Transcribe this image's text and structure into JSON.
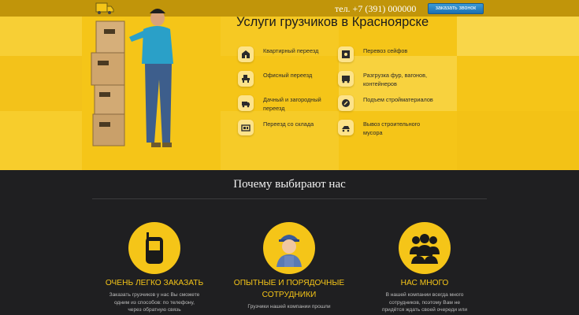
{
  "header": {
    "phone": "тел. +7 (391) 000000",
    "call_button": "заказать звонок"
  },
  "hero": {
    "title": "Услуги грузчиков в Красноярске",
    "services": [
      {
        "label": "Квартирный переезд",
        "icon": "apartment-move-icon"
      },
      {
        "label": "Перевоз сейфов",
        "icon": "safe-icon"
      },
      {
        "label": "Офисный переезд",
        "icon": "office-move-icon"
      },
      {
        "label": "Разгрузка фур, вагонов, контейнеров",
        "icon": "truck-unload-icon"
      },
      {
        "label": "Дачный и загородный переезд",
        "icon": "country-move-icon"
      },
      {
        "label": "Подъем стройматериалов",
        "icon": "building-materials-icon"
      },
      {
        "label": "Переезд со склада",
        "icon": "warehouse-move-icon"
      },
      {
        "label": "Вывоз строительного мусора",
        "icon": "debris-removal-icon"
      }
    ]
  },
  "why": {
    "title": "Почему выбирают нас",
    "features": [
      {
        "icon": "mobile-phone-icon",
        "title": "ОЧЕНЬ ЛЕГКО ЗАКАЗАТЬ",
        "text": "Заказать грузчиков у нас Вы сможете одним из способов: по телефону, через обратную связь"
      },
      {
        "icon": "worker-icon",
        "title": "ОПЫТНЫЕ И ПОРЯДОЧНЫЕ СОТРУДНИКИ",
        "text": "Грузчики нашей компании прошли"
      },
      {
        "icon": "team-icon",
        "title": "НАС МНОГО",
        "text": "В нашей компании всегда много сотрудников, поэтому Вам не придётся ждать своей очереди или"
      }
    ]
  },
  "colors": {
    "accent": "#f5c518",
    "dark_bg": "#1f1f21",
    "button": "#1c6fb1"
  }
}
